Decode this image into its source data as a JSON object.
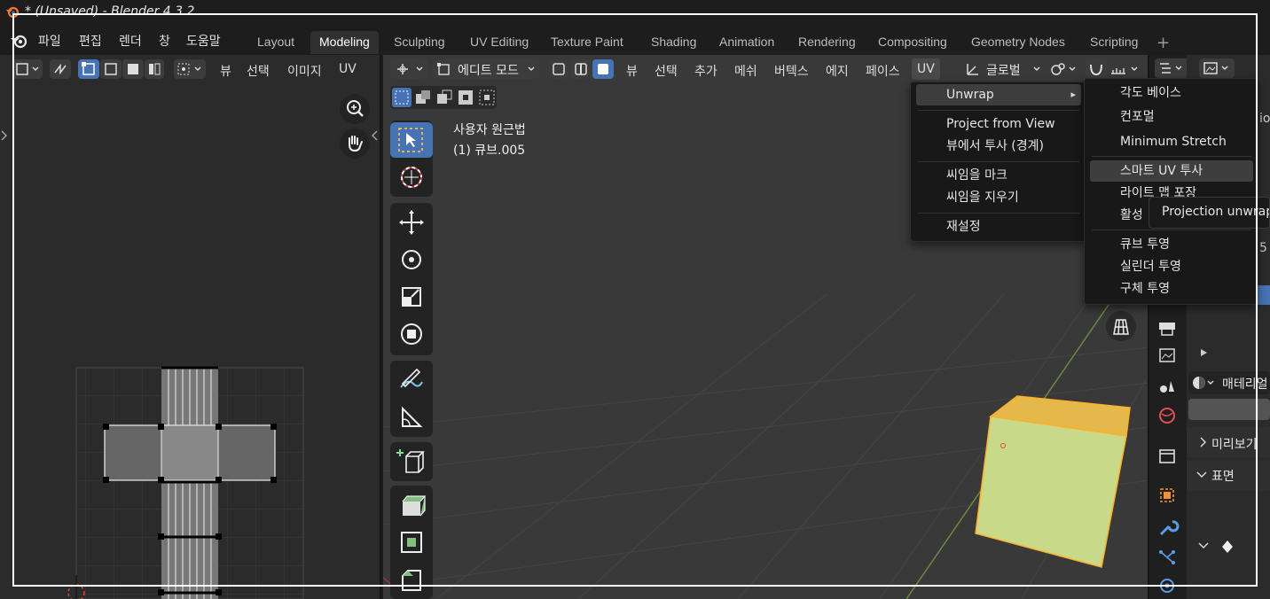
{
  "window": {
    "title": "* (Unsaved) - Blender 4.3.2"
  },
  "main_menu": [
    "파일",
    "편집",
    "렌더",
    "창",
    "도움말"
  ],
  "workspaces": [
    "Layout",
    "Modeling",
    "Sculpting",
    "UV Editing",
    "Texture Paint",
    "Shading",
    "Animation",
    "Rendering",
    "Compositing",
    "Geometry Nodes",
    "Scripting"
  ],
  "active_workspace": "Modeling",
  "add_workspace": "+",
  "uv_editor": {
    "menus": [
      "뷰",
      "선택",
      "이미지",
      "UV"
    ]
  },
  "viewport": {
    "mode": "에디트 모드",
    "menus": [
      "뷰",
      "선택",
      "추가",
      "메쉬",
      "버텍스",
      "에지",
      "페이스",
      "UV"
    ],
    "active_menu": "UV",
    "orientation": "글로벌",
    "view_name": "사용자 원근법",
    "object_name": "(1) 큐브.005"
  },
  "uv_menu": {
    "items": [
      {
        "label": "Unwrap",
        "submenu": true,
        "highlighted": true
      },
      {
        "label": "Project from View"
      },
      {
        "label": "뷰에서 투사 (경계)"
      },
      {
        "label": "씨임을 마크"
      },
      {
        "label": "씨임을 지우기"
      },
      {
        "label": "재설정"
      }
    ],
    "submenu_arrow": "▸"
  },
  "unwrap_submenu": {
    "items": [
      {
        "label": "각도 베이스"
      },
      {
        "label": "컨포멀"
      },
      {
        "label": "Minimum Stretch"
      },
      {
        "label": "스마트 UV 투사",
        "highlighted": true
      },
      {
        "label": "라이트 맵 포장"
      },
      {
        "label": "활성 "
      },
      {
        "label": "큐브 투영"
      },
      {
        "label": "실린더 투영"
      },
      {
        "label": "구체 투영"
      }
    ]
  },
  "tooltip": {
    "text": "Projection unwraps"
  },
  "properties": {
    "material_label": "매테리얼",
    "preview_label": "미리보기",
    "surface_label": "표면",
    "num_5": "5",
    "clip_io": "io"
  },
  "colors": {
    "accent_blue": "#4772b3",
    "selected_orange": "#ffaf29",
    "cube_face": "#c9d98a",
    "menu_bg": "#181818"
  }
}
